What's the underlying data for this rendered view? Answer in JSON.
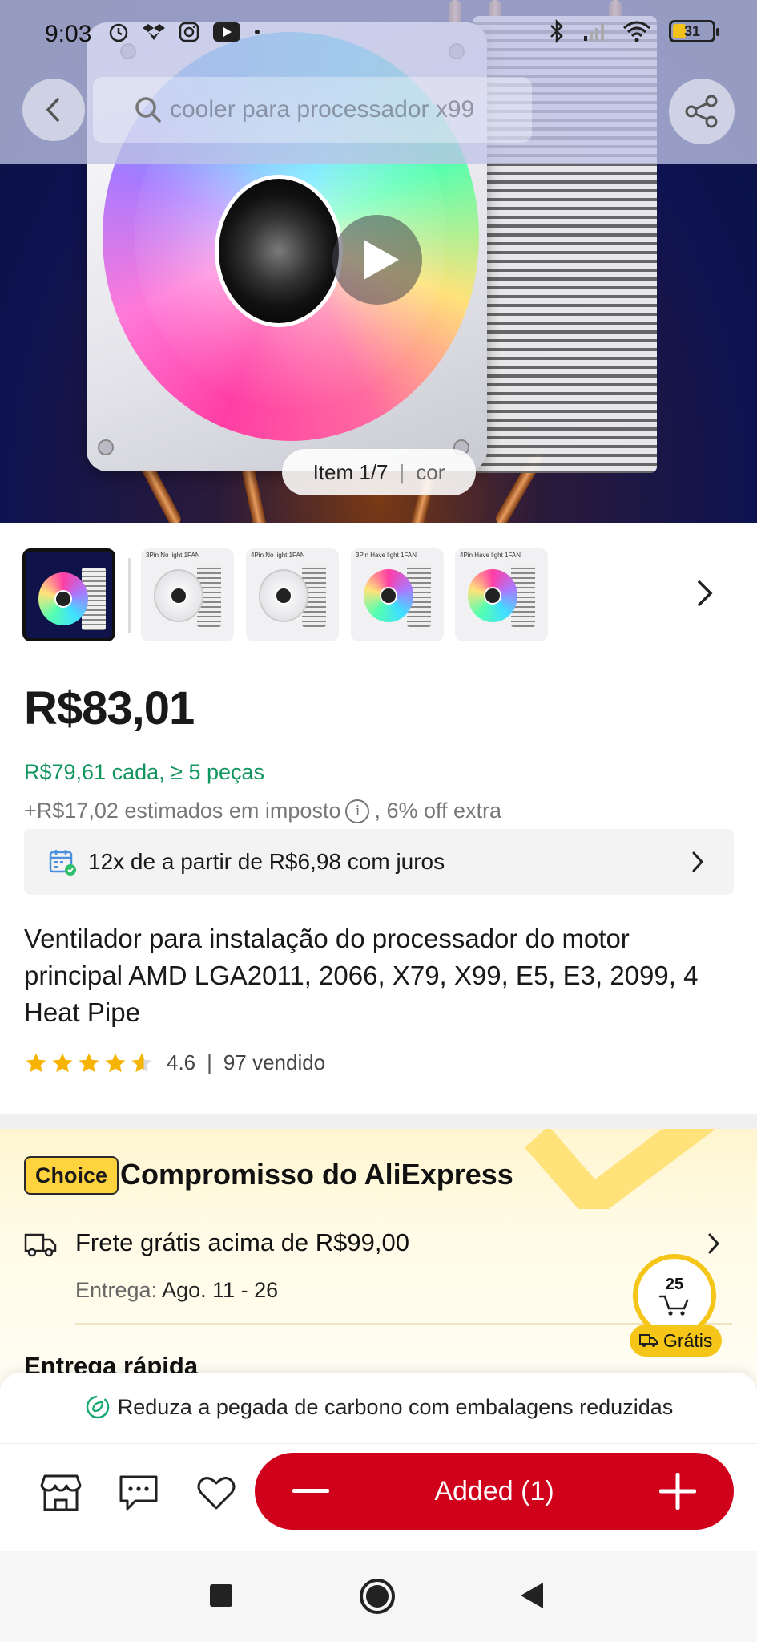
{
  "status_bar": {
    "time": "9:03",
    "battery": "31",
    "icons_left": [
      "alarm-icon",
      "dropbox-icon",
      "instagram-icon",
      "youtube-icon",
      "dot-icon"
    ],
    "icons_right": [
      "bluetooth-icon",
      "signal-icon",
      "wifi-icon",
      "battery-icon"
    ]
  },
  "header": {
    "search_placeholder": "cooler para processador x99"
  },
  "gallery": {
    "counter": "Item 1/7",
    "counter_tag": "cor",
    "thumbnails": [
      {
        "label": "",
        "style": "rgb-selected"
      },
      {
        "label": "3Pin No light 1FAN",
        "style": "white"
      },
      {
        "label": "4Pin No light 1FAN",
        "style": "white"
      },
      {
        "label": "3Pin Have light 1FAN",
        "style": "rgb"
      },
      {
        "label": "4Pin Have light 1FAN",
        "style": "rgb"
      }
    ]
  },
  "product": {
    "price": "R$83,01",
    "bulk_price": "R$79,61 cada, ≥ 5 peças",
    "tax_prefix": "+R$17,02 estimados em imposto",
    "tax_suffix": ", 6% off extra",
    "installments": "12x de a partir de R$6,98 com juros",
    "title": "Ventilador para instalação do processador do motor principal AMD LGA2011, 2066, X79, X99, E5, E3, 2099, 4 Heat Pipe",
    "rating": "4.6",
    "rating_fraction": 0.92,
    "sold": "97 vendido"
  },
  "choice": {
    "badge": "Choice",
    "title": "Compromisso do AliExpress",
    "shipping_title": "Frete grátis acima de R$99,00",
    "delivery_label": "Entrega:",
    "delivery_dates": "Ago. 11 - 26",
    "next_row_partial": "Entrega rápida"
  },
  "cart_float": {
    "count": "25",
    "gratis": "Grátis"
  },
  "bottom_sheet": {
    "eco_text": "Reduza a pegada de carbono com embalagens reduzidas",
    "cart_button": "Added (1)"
  },
  "colors": {
    "brand_red": "#d0021b",
    "green_price": "#11955e",
    "choice_yellow": "#ffd33d"
  }
}
